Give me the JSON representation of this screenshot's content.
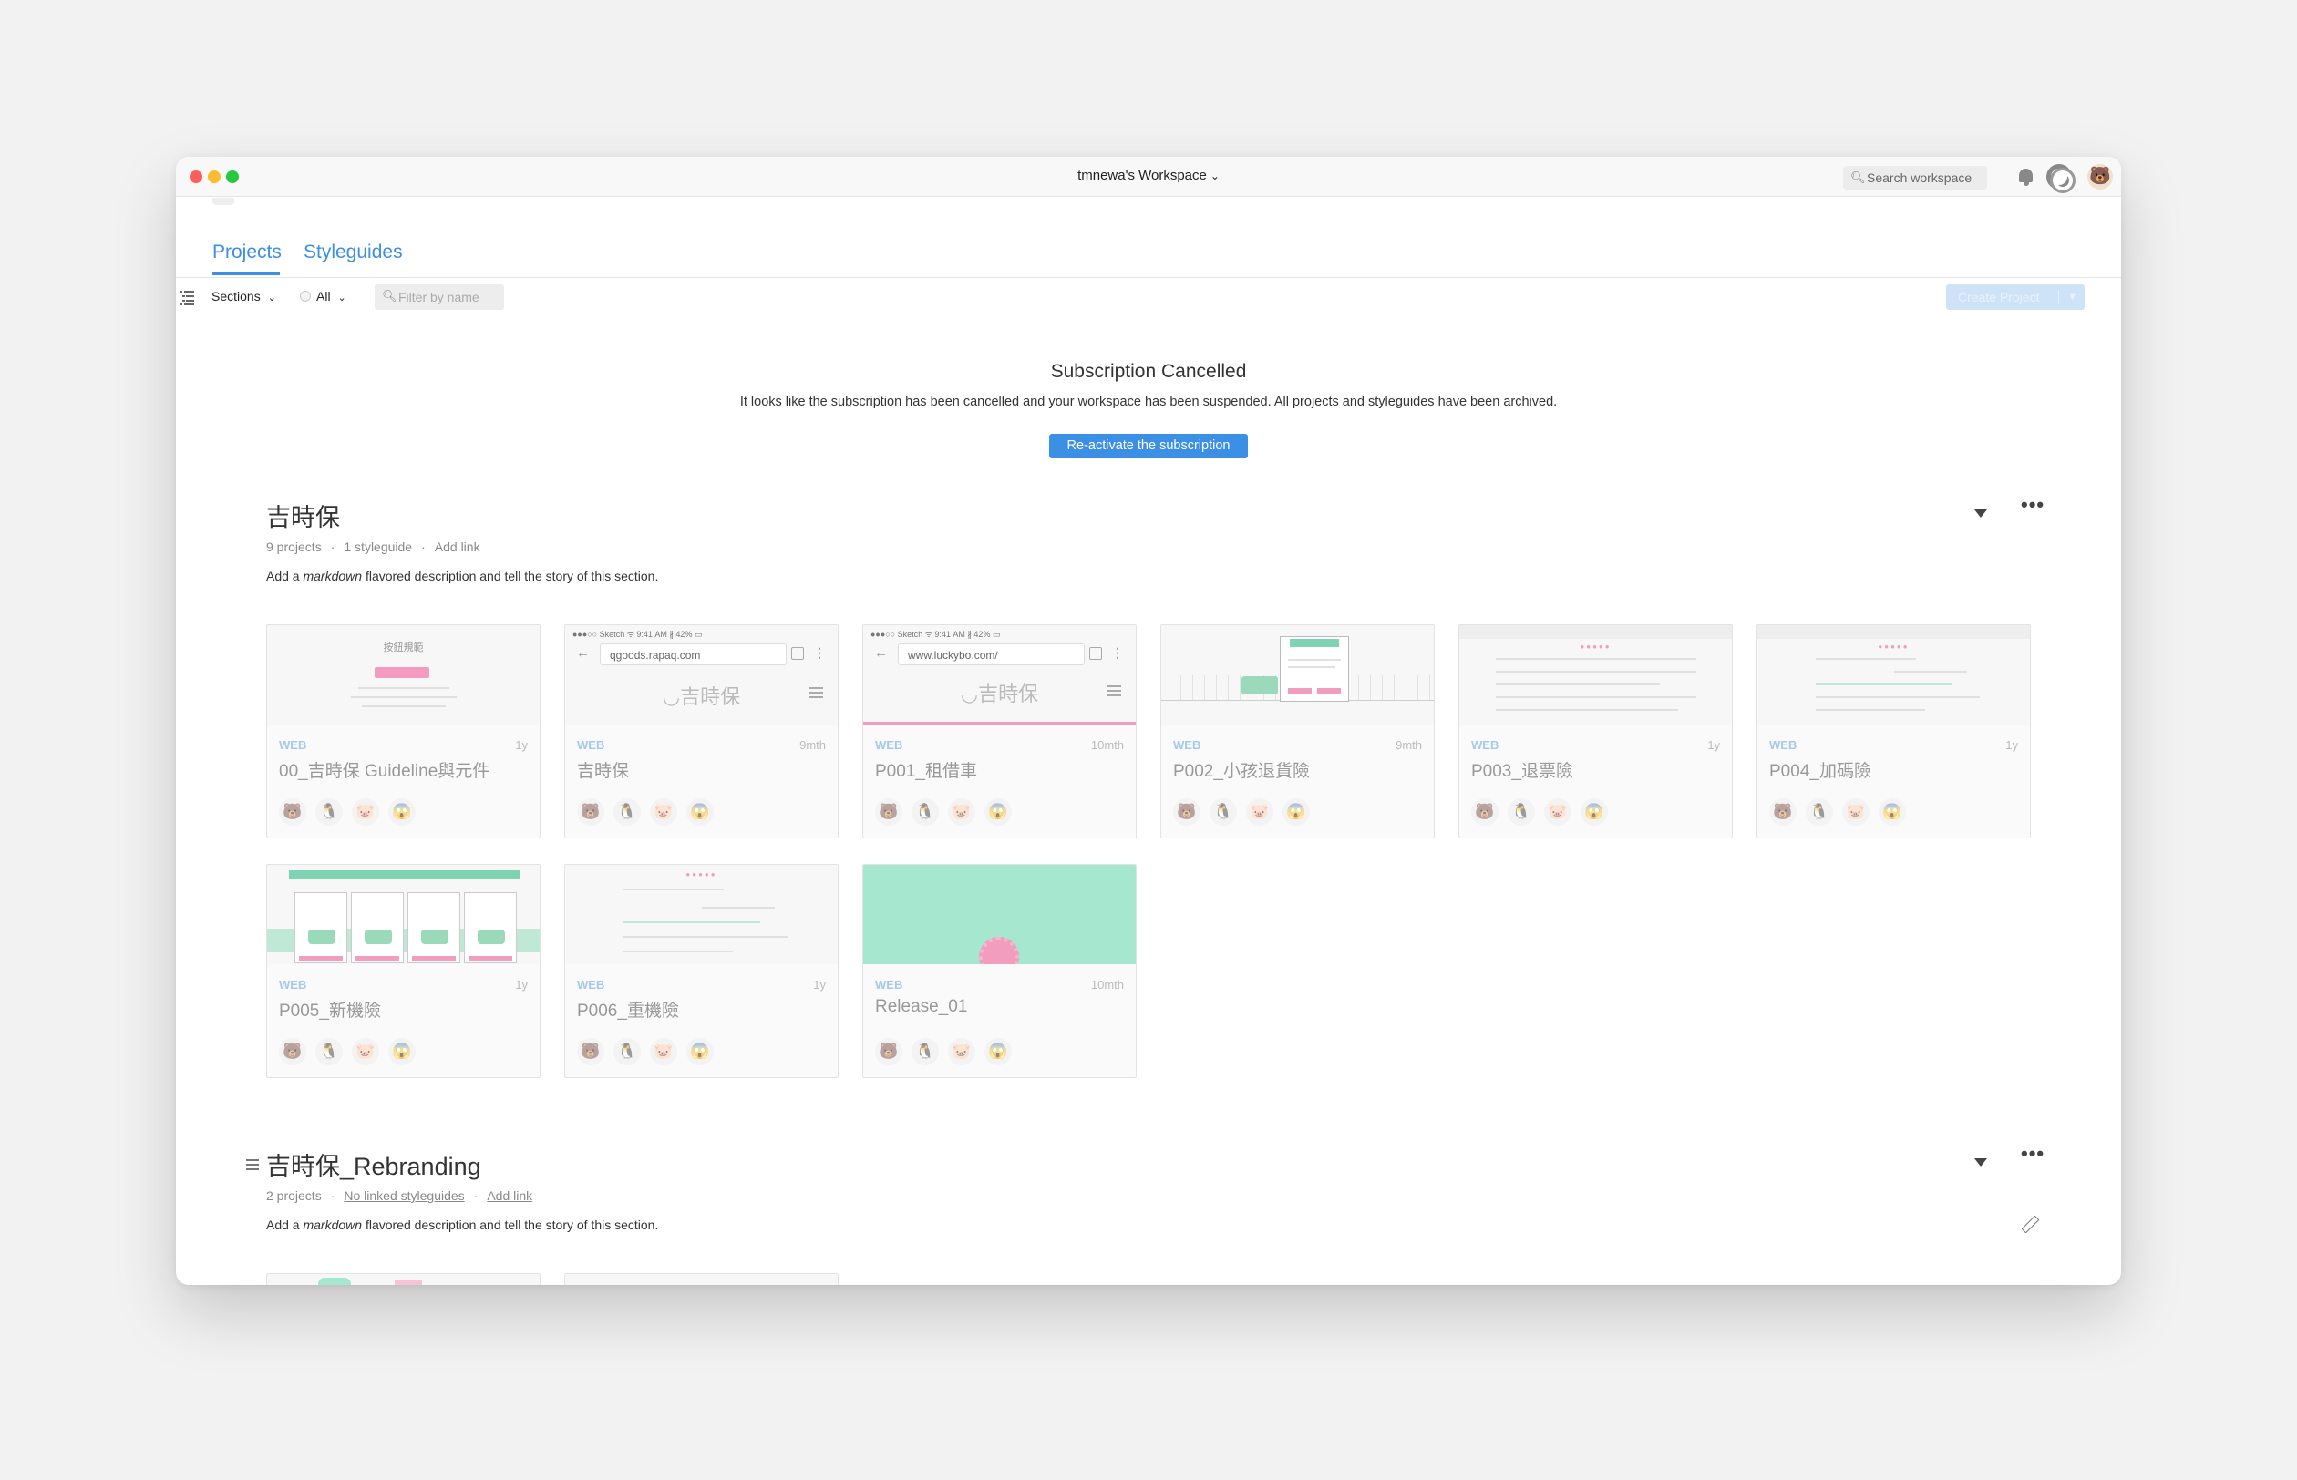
{
  "window": {
    "workspace_title": "tmnewa's Workspace",
    "search_label": "Search workspace"
  },
  "tabs": {
    "projects": "Projects",
    "styleguides": "Styleguides"
  },
  "toolbar": {
    "sections_label": "Sections",
    "all_label": "All",
    "filter_placeholder": "Filter by name",
    "create_label": "Create Project"
  },
  "notice": {
    "title": "Subscription Cancelled",
    "text": "It looks like the subscription has been cancelled and your workspace has been suspended. All projects and styleguides have been archived.",
    "button": "Re-activate the subscription"
  },
  "sections": [
    {
      "title": "吉時保",
      "projects_count": "9 projects",
      "styleguides": "1 styleguide",
      "add_link": "Add link",
      "desc_pre": "Add a ",
      "desc_em": "markdown",
      "desc_post": " flavored description and tell the story of this section.",
      "projects": [
        {
          "type": "WEB",
          "age": "1y",
          "name": "00_吉時保 Guideline與元件",
          "thumb_title": "按鈕規範"
        },
        {
          "type": "WEB",
          "age": "9mth",
          "name": "吉時保",
          "status": "●●●○○ Sketch ᯤ      9:41 AM       ∦ 42% ▭",
          "url": "qgoods.rapaq.com",
          "logo": "◡吉時保"
        },
        {
          "type": "WEB",
          "age": "10mth",
          "name": "P001_租借車",
          "status": "●●●○○ Sketch ᯤ      9:41 AM       ∦ 42% ▭",
          "url": "www.luckybo.com/",
          "logo": "◡吉時保"
        },
        {
          "type": "WEB",
          "age": "9mth",
          "name": "P002_小孩退貨險"
        },
        {
          "type": "WEB",
          "age": "1y",
          "name": "P003_退票險",
          "steps": "●●●●●"
        },
        {
          "type": "WEB",
          "age": "1y",
          "name": "P004_加碼險",
          "steps": "●●●●●"
        },
        {
          "type": "WEB",
          "age": "1y",
          "name": "P005_新機險"
        },
        {
          "type": "WEB",
          "age": "1y",
          "name": "P006_重機險",
          "steps": "●●●●●"
        },
        {
          "type": "WEB",
          "age": "10mth",
          "name": "Release_01"
        }
      ]
    },
    {
      "title": "吉時保_Rebranding",
      "projects_count": "2 projects",
      "styleguides": "No linked styleguides",
      "add_link": "Add link",
      "desc_pre": "Add a ",
      "desc_em": "markdown",
      "desc_post": " flavored description and tell the story of this section."
    }
  ],
  "avatars": [
    "🐻",
    "🐧",
    "🐷",
    "😱"
  ],
  "icons": {
    "search": "search-icon",
    "bell": "bell-icon",
    "help": "lifebuoy-icon",
    "user": "bear-avatar-icon"
  },
  "colors": {
    "accent": "#3b8fe4",
    "type_label": "#a5c9ee",
    "mint": "#7dd3b2",
    "pink": "#f29cbe"
  }
}
